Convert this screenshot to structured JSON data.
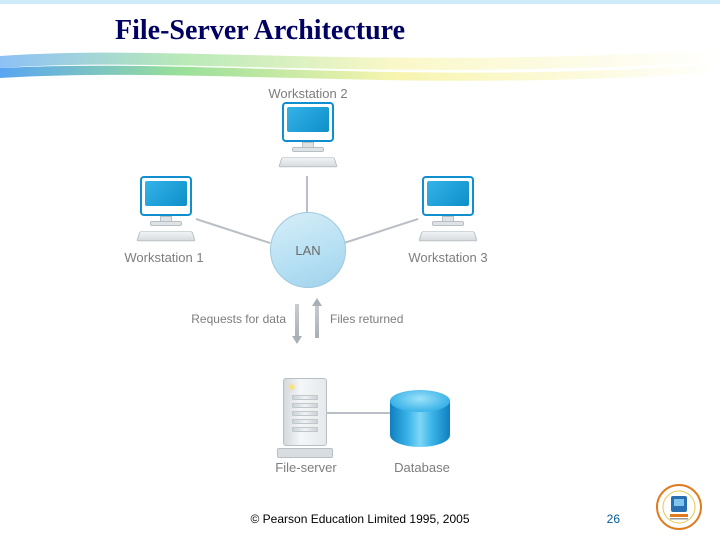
{
  "title": "File-Server Architecture",
  "diagram": {
    "lan_label": "LAN",
    "workstations": [
      {
        "label": "Workstation 1"
      },
      {
        "label": "Workstation 2"
      },
      {
        "label": "Workstation 3"
      }
    ],
    "request_label": "Requests for data",
    "return_label": "Files returned",
    "fileserver_label": "File-server",
    "database_label": "Database"
  },
  "footer": {
    "copyright": "© Pearson Education Limited 1995, 2005",
    "page_number": "26"
  },
  "colors": {
    "accent": "#0f8fcf",
    "title": "#000063"
  }
}
